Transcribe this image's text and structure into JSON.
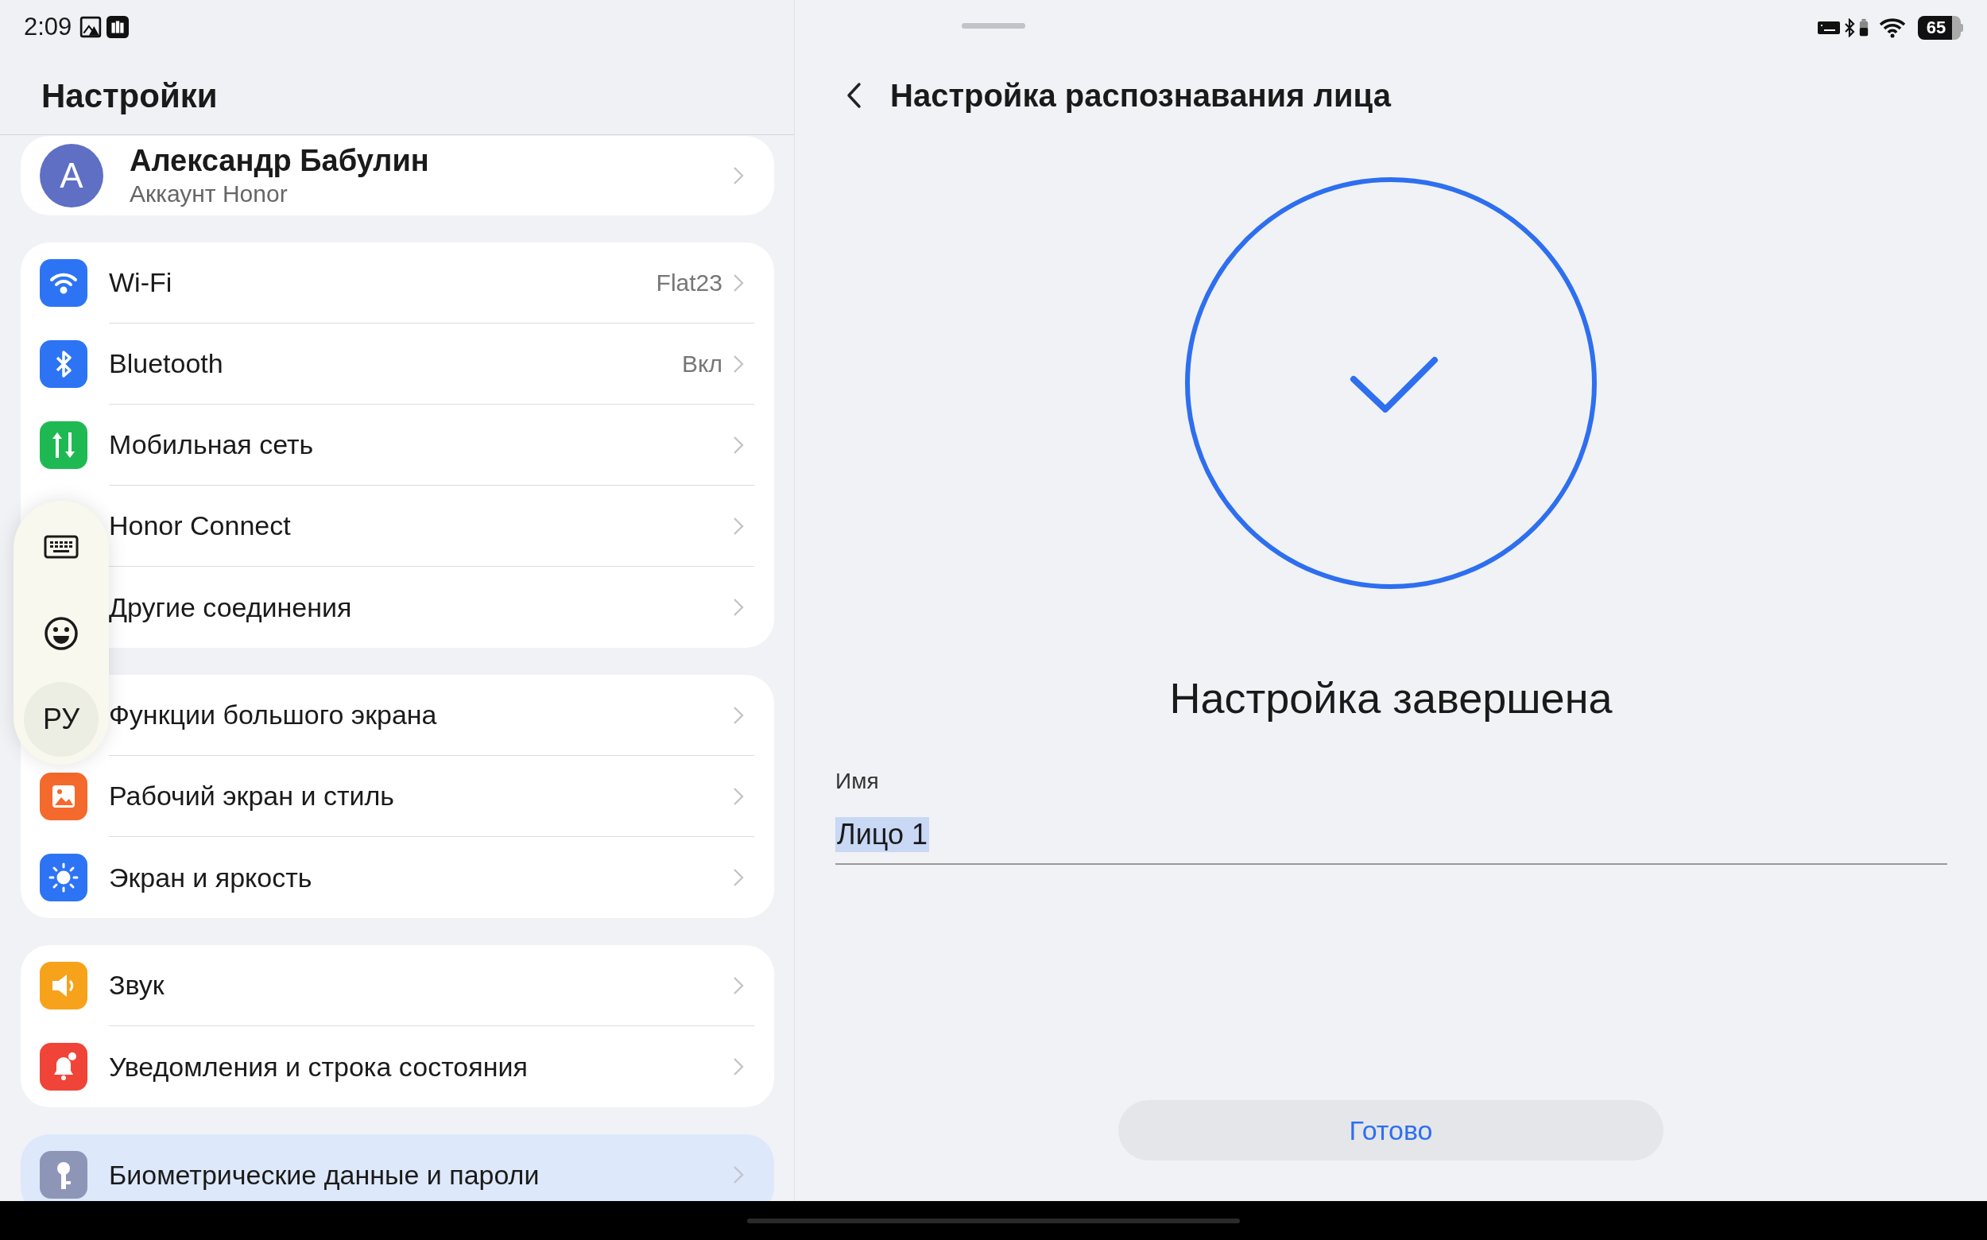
{
  "status_bar": {
    "time": "2:09",
    "battery": "65"
  },
  "settings": {
    "title": "Настройки",
    "account": {
      "avatar": "A",
      "name": "Александр Бабулин",
      "subtitle": "Аккаунт Honor"
    },
    "groups": [
      {
        "items": [
          {
            "label": "Wi-Fi",
            "value": "Flat23",
            "selected": false
          },
          {
            "label": "Bluetooth",
            "value": "Вкл",
            "selected": false
          },
          {
            "label": "Мобильная сеть",
            "selected": false
          },
          {
            "label": "Honor Connect",
            "selected": false
          },
          {
            "label": "Другие соединения",
            "selected": false
          }
        ]
      },
      {
        "items": [
          {
            "label": "Функции большого экрана",
            "selected": false
          },
          {
            "label": "Рабочий экран и стиль",
            "selected": false
          },
          {
            "label": "Экран и яркость",
            "selected": false
          }
        ]
      },
      {
        "items": [
          {
            "label": "Звук",
            "selected": false
          },
          {
            "label": "Уведомления и строка состояния",
            "selected": false
          }
        ]
      },
      {
        "items": [
          {
            "label": "Биометрические данные и пароли",
            "selected": true
          }
        ]
      }
    ]
  },
  "floating_toolbar": {
    "language": "РУ"
  },
  "detail": {
    "title": "Настройка распознавания лица",
    "status": "Настройка завершена",
    "name_field": {
      "label": "Имя",
      "value": "Лицо 1",
      "text_selected": true
    },
    "done_button": "Готово"
  }
}
